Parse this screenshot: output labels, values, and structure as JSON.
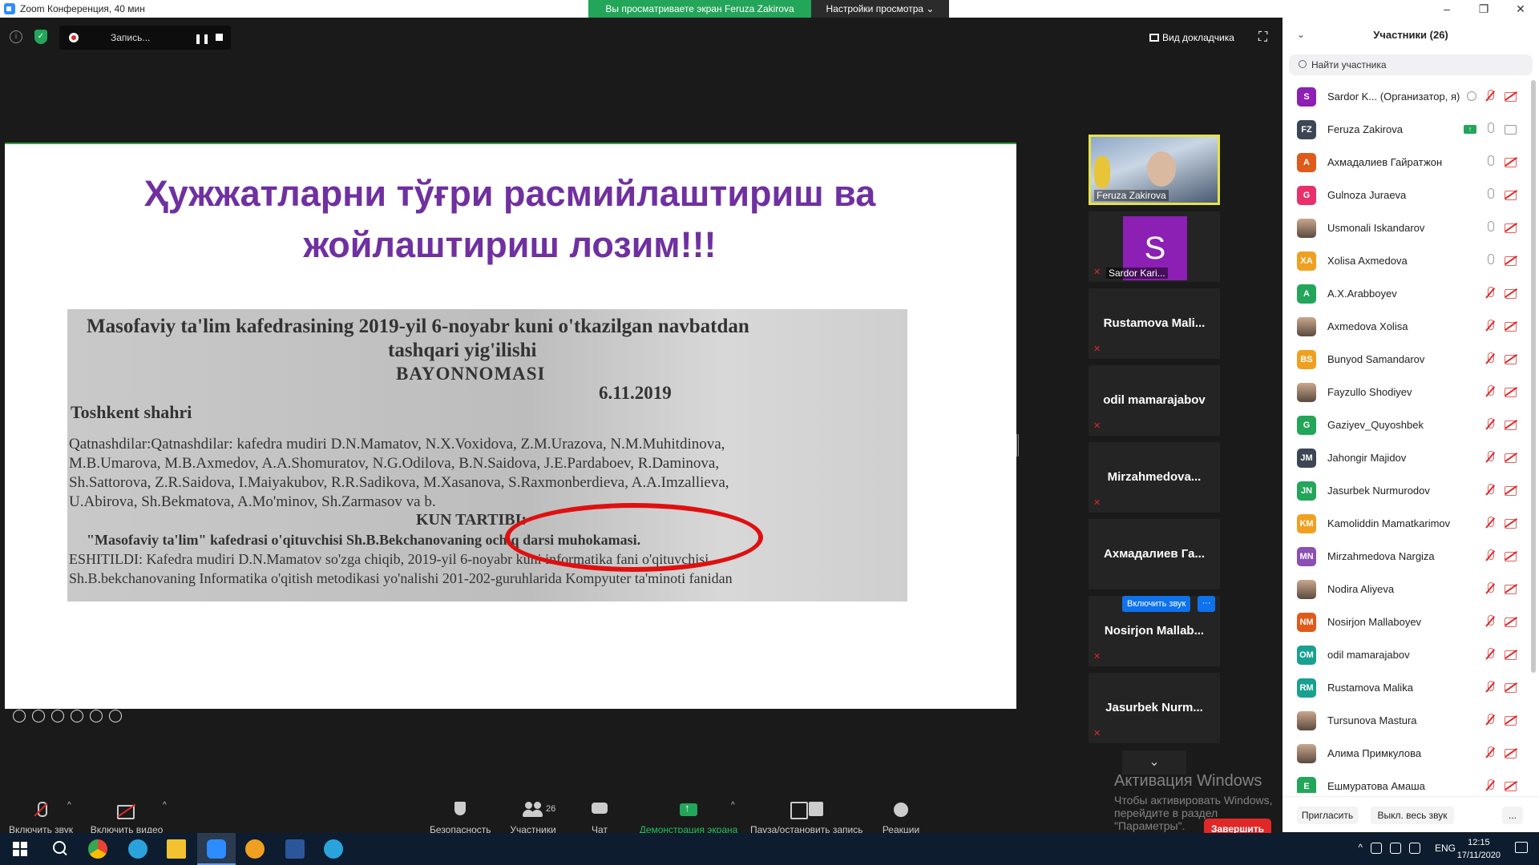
{
  "window": {
    "title": "Zoom Конференция, 40 мин",
    "share_banner": "Вы просматриваете экран Feruza Zakirova",
    "view_options": "Настройки просмотра ⌄",
    "minimize": "–",
    "restore": "❐",
    "close": "✕"
  },
  "topbar": {
    "recording_label": "Запись...",
    "pause_glyph": "❚❚",
    "speaker_view": "Вид докладчика",
    "fullscreen_glyph": "⛶",
    "info_glyph": "i",
    "shield_glyph": "✓"
  },
  "slide": {
    "title_line1": "Ҳужжатларни тўғри расмийлаштириш ва",
    "title_line2": "жойлаштириш лозим!!!",
    "doc": {
      "header1": "Masofaviy ta'lim kafedrasining 2019-yil 6-noyabr kuni  o'tkazilgan navbatdan",
      "header2": "tashqari yig'ilishi",
      "header3": "BAYONNOMASI",
      "date": "6.11.2019",
      "city": "Toshkent shahri",
      "line1": "Qatnashdilar:Qatnashdilar:  kafedra  mudiri  D.N.Mamatov,  N.X.Voxidova,  Z.M.Urazova,  N.M.Muhitdinova,",
      "line2": "M.B.Umarova,  M.B.Axmedov,  A.A.Shomuratov,  N.G.Odilova,     B.N.Saidova,  J.E.Pardaboev,  R.Daminova,",
      "line3": "Sh.Sattorova,  Z.R.Saidova,  I.Maiyakubov,  R.R.Sadikova,  M.Xasanova,  S.Raxmonberdieva,  A.A.Imzallieva,",
      "line4": "U.Abirova, Sh.Bekmatova, A.Mo'minov, Sh.Zarmasov va b.",
      "agenda": "KUN TARTIBI:",
      "line5": "\"Masofaviy ta'lim\" kafedrasi o'qituvchisi Sh.B.Bekchanovaning ochiq darsi muhokamasi.",
      "line6": "ESHITILDI: Kafedra mudiri D.N.Mamatov so'zga chiqib, 2019-yil 6-noyabr kuni informatika fani o'qituvchisi",
      "line7": "Sh.B.bekchanovaning Informatika o'qitish metodikasi yo'nalishi 201-202-guruhlarida Kompyuter ta'minoti fanidan"
    }
  },
  "thumbnails": [
    {
      "name": "Feruza Zakirova"
    },
    {
      "name": "Sardor Kari...",
      "initial": "S"
    },
    {
      "name": "Rustamova Mali..."
    },
    {
      "name": "odil mamarajabov"
    },
    {
      "name": "Mirzahmedova..."
    },
    {
      "name": "Ахмадалиев Га..."
    },
    {
      "name": "Nosirjon Mallab...",
      "unmute": "Включить звук",
      "more": "···"
    },
    {
      "name": "Jasurbek Nurm..."
    }
  ],
  "watermark": {
    "line1": "Активация Windows",
    "line2": "Чтобы активировать Windows, перейдите в раздел \"Параметры\"."
  },
  "toolbar": {
    "unmute": "Включить звук",
    "start_video": "Включить видео",
    "security": "Безопасность",
    "participants": "Участники",
    "participants_count": "26",
    "chat": "Чат",
    "share_screen": "Демонстрация экрана",
    "pause_record": "Пауза/остановить запись",
    "reactions": "Реакции",
    "end": "Завершить",
    "caret": "^"
  },
  "participants_panel": {
    "title": "Участники (26)",
    "search_placeholder": "Найти участника",
    "collapse_glyph": "⌄",
    "people": [
      {
        "initials": "S",
        "color": "#8c1fb4",
        "name": "Sardor K...   (Организатор, я)"
      },
      {
        "initials": "FZ",
        "color": "#3d4654",
        "name": "Feruza Zakirova"
      },
      {
        "initials": "A",
        "color": "#e05a1a",
        "name": "Ахмадалиев Гайратжон"
      },
      {
        "initials": "G",
        "color": "#e8306c",
        "name": "Gulnoza Juraeva"
      },
      {
        "initials": "",
        "color": "photo",
        "name": "Usmonali Iskandarov"
      },
      {
        "initials": "XA",
        "color": "#f0a020",
        "name": "Xolisa Axmedova"
      },
      {
        "initials": "A",
        "color": "#23a55a",
        "name": "A.X.Arabboyev"
      },
      {
        "initials": "",
        "color": "photo",
        "name": "Axmedova Xolisa"
      },
      {
        "initials": "BS",
        "color": "#f0a020",
        "name": "Bunyod Samandarov"
      },
      {
        "initials": "",
        "color": "photo",
        "name": "Fayzullo Shodiyev"
      },
      {
        "initials": "G",
        "color": "#23a55a",
        "name": "Gaziyev_Quyoshbek"
      },
      {
        "initials": "JM",
        "color": "#3d4654",
        "name": "Jahongir Majidov"
      },
      {
        "initials": "JN",
        "color": "#23a55a",
        "name": "Jasurbek Nurmurodov"
      },
      {
        "initials": "KM",
        "color": "#f0a020",
        "name": "Kamoliddin Mamatkarimov"
      },
      {
        "initials": "MN",
        "color": "#8c4fb4",
        "name": "Mirzahmedova Nargiza"
      },
      {
        "initials": "",
        "color": "photo",
        "name": "Nodira Aliyeva"
      },
      {
        "initials": "NM",
        "color": "#e05a1a",
        "name": "Nosirjon Mallaboyev"
      },
      {
        "initials": "OM",
        "color": "#1aa090",
        "name": "odil mamarajabov"
      },
      {
        "initials": "RM",
        "color": "#1aa090",
        "name": "Rustamova Malika"
      },
      {
        "initials": "",
        "color": "photo",
        "name": "Tursunova Mastura"
      },
      {
        "initials": "",
        "color": "photo",
        "name": "Алима Примкулова"
      },
      {
        "initials": "E",
        "color": "#23a55a",
        "name": "Ешмуратова Амаша"
      }
    ],
    "invite": "Пригласить",
    "mute_all": "Выкл. весь звук",
    "more": "..."
  },
  "taskbar": {
    "lang": "ENG",
    "time": "12:15",
    "date": "17/11/2020",
    "tray_caret": "^"
  }
}
